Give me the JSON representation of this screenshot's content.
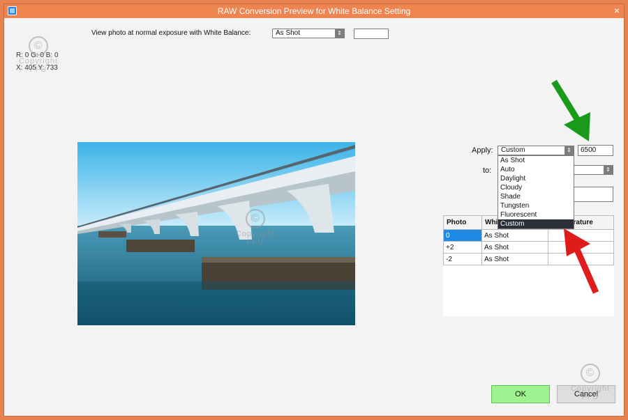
{
  "window": {
    "title": "RAW Conversion Preview for White Balance Setting",
    "close_glyph": "×"
  },
  "exposure_row": {
    "label": "View photo at normal exposure with White Balance:",
    "value": "As Shot",
    "text_value": ""
  },
  "readouts": {
    "rgb": "R: 0  G: 0  B: 0",
    "xy": "X: 405  Y: 733"
  },
  "watermark": {
    "symbol": "©",
    "line1": "Copyright",
    "line2": "FFU"
  },
  "apply": {
    "label": "Apply:",
    "value": "Custom",
    "temperature": "6500",
    "options": [
      "As Shot",
      "Auto",
      "Daylight",
      "Cloudy",
      "Shade",
      "Tungsten",
      "Fluorescent",
      "Custom"
    ],
    "selected_option": "Custom"
  },
  "to": {
    "label": "to:",
    "text_value": ""
  },
  "table": {
    "headers": [
      "Photo",
      "White Balance",
      "Temperature"
    ],
    "rows": [
      [
        "0",
        "As Shot",
        ""
      ],
      [
        "+2",
        "As Shot",
        ""
      ],
      [
        "-2",
        "As Shot",
        ""
      ]
    ]
  },
  "buttons": {
    "ok": "OK",
    "cancel": "Cancel"
  },
  "colors": {
    "title_bar": "#ee8550",
    "frame": "#e8834f",
    "ok_button": "#9ef28f",
    "selection": "#1e8ae6",
    "green_arrow": "#1a9a1a",
    "red_arrow": "#e01b1b"
  }
}
